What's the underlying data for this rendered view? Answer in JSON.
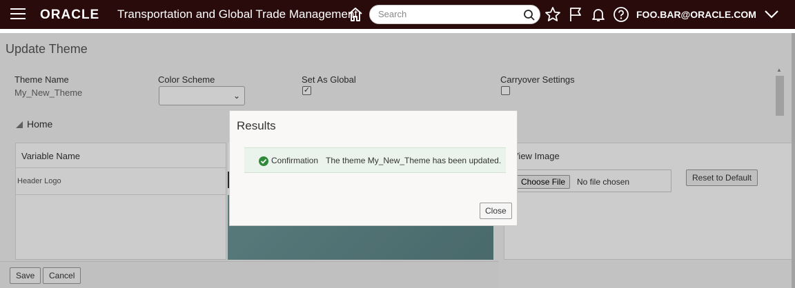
{
  "header": {
    "logo": "ORACLE",
    "app_title": "Transportation and Global Trade Management",
    "search_placeholder": "Search",
    "user": "FOO.BAR@ORACLE.COM"
  },
  "page": {
    "title": "Update Theme",
    "fields": {
      "theme_name_label": "Theme Name",
      "theme_name_value": "My_New_Theme",
      "color_scheme_label": "Color Scheme",
      "set_as_global_label": "Set As Global",
      "set_as_global_checked": true,
      "carryover_label": "Carryover Settings",
      "carryover_checked": false
    },
    "section": "Home",
    "table": {
      "col_variable": "Variable Name",
      "row_variable": "Header Logo",
      "view_image_label": "View Image",
      "choose_file_label": "Choose File",
      "no_file_text": "No file chosen",
      "reset_label": "Reset to Default"
    },
    "buttons": {
      "save": "Save",
      "cancel": "Cancel"
    }
  },
  "dialog": {
    "title": "Results",
    "confirm_label": "Confirmation",
    "confirm_message": "The theme My_New_Theme has been updated.",
    "close": "Close"
  }
}
